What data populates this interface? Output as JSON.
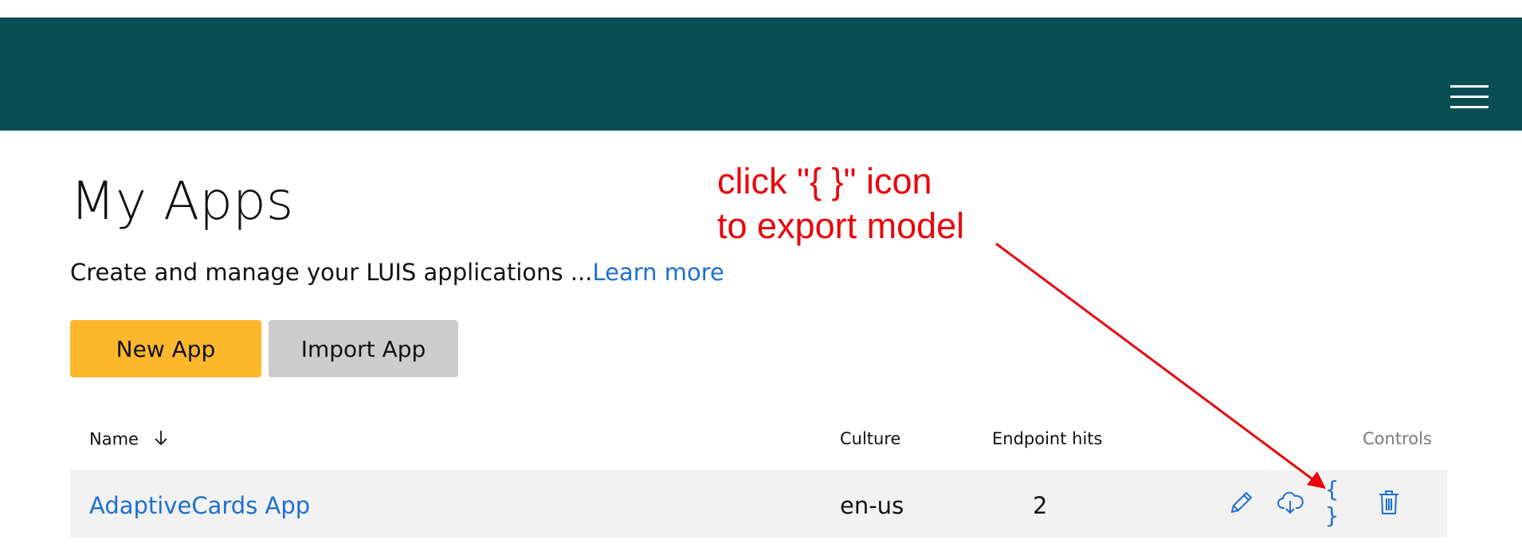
{
  "header": {
    "menu_icon": "hamburger-menu-icon"
  },
  "page": {
    "title": "My Apps",
    "subtitle_text": "Create and manage your LUIS applications ...",
    "learn_more_label": "Learn more"
  },
  "buttons": {
    "new_app_label": "New App",
    "import_app_label": "Import App"
  },
  "table": {
    "columns": {
      "name": "Name",
      "culture": "Culture",
      "endpoint_hits": "Endpoint hits",
      "controls": "Controls"
    },
    "sort_icon": "arrow-down-icon",
    "rows": [
      {
        "name": "AdaptiveCards App",
        "culture": "en-us",
        "endpoint_hits": "2",
        "controls": [
          "pencil-edit-icon",
          "cloud-download-icon",
          "braces-export-icon",
          "trash-delete-icon"
        ]
      }
    ],
    "export_glyph": "{ }"
  },
  "annotation": {
    "text": "click \"{ }\" icon\nto export model",
    "color": "#e8060c"
  },
  "colors": {
    "header_bg": "#074d52",
    "accent_link": "#1e6fd0",
    "primary_button": "#fdb72d",
    "secondary_button": "#cdcdcd",
    "row_bg": "#f2f2f2"
  }
}
